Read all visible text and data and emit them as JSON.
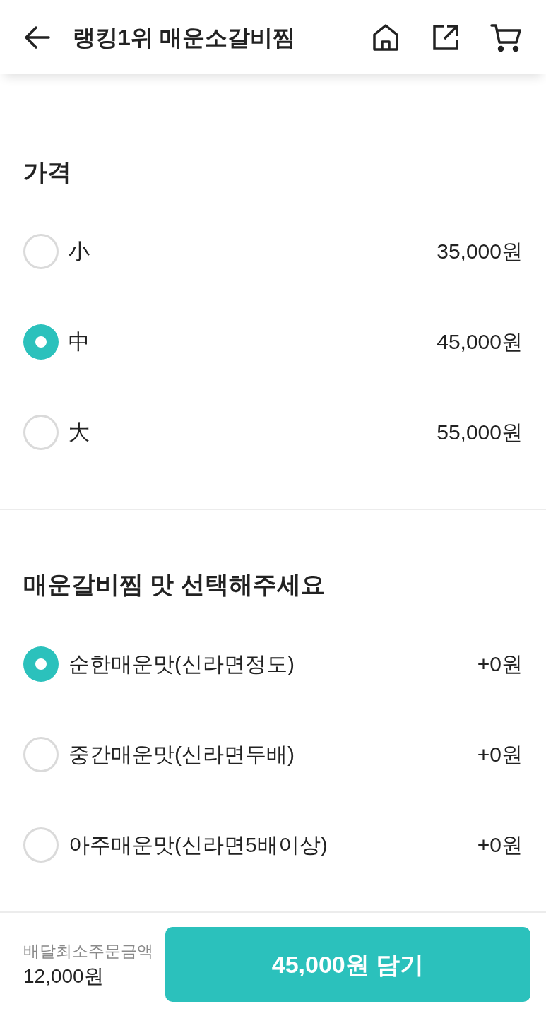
{
  "header": {
    "title": "랭킹1위 매운소갈비찜"
  },
  "option_groups": [
    {
      "title": "가격",
      "options": [
        {
          "label": "小",
          "price": "35,000원",
          "selected": false
        },
        {
          "label": "中",
          "price": "45,000원",
          "selected": true
        },
        {
          "label": "大",
          "price": "55,000원",
          "selected": false
        }
      ]
    },
    {
      "title": "매운갈비찜 맛 선택해주세요",
      "options": [
        {
          "label": "순한매운맛(신라면정도)",
          "price": "+0원",
          "selected": true
        },
        {
          "label": "중간매운맛(신라면두배)",
          "price": "+0원",
          "selected": false
        },
        {
          "label": "아주매운맛(신라면5배이상)",
          "price": "+0원",
          "selected": false
        }
      ]
    }
  ],
  "footer": {
    "min_order_label": "배달최소주문금액",
    "min_order_amount": "12,000원",
    "add_button": "45,000원 담기"
  }
}
